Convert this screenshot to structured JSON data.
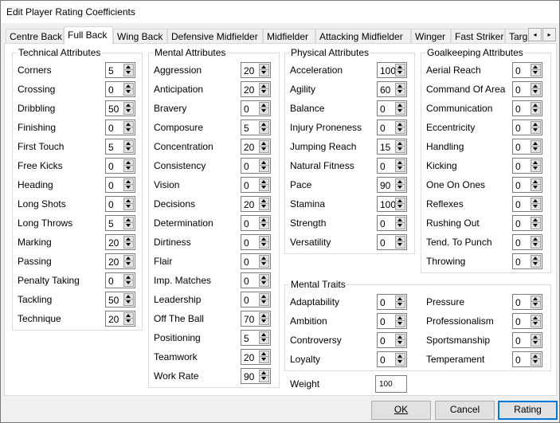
{
  "window": {
    "title": "Edit Player Rating Coefficients"
  },
  "tabs": [
    {
      "label": "Centre Back"
    },
    {
      "label": "Full Back",
      "active": true
    },
    {
      "label": "Wing Back"
    },
    {
      "label": "Defensive Midfielder"
    },
    {
      "label": "Midfielder"
    },
    {
      "label": "Attacking Midfielder"
    },
    {
      "label": "Winger"
    },
    {
      "label": "Fast Striker"
    },
    {
      "label": "Targ"
    }
  ],
  "tab_scroll": {
    "left_icon": "◂",
    "right_icon": "▸"
  },
  "groups": {
    "technical": {
      "title": "Technical Attributes",
      "items": [
        {
          "label": "Corners",
          "value": "5"
        },
        {
          "label": "Crossing",
          "value": "0"
        },
        {
          "label": "Dribbling",
          "value": "50"
        },
        {
          "label": "Finishing",
          "value": "0"
        },
        {
          "label": "First Touch",
          "value": "5"
        },
        {
          "label": "Free Kicks",
          "value": "0"
        },
        {
          "label": "Heading",
          "value": "0"
        },
        {
          "label": "Long Shots",
          "value": "0"
        },
        {
          "label": "Long Throws",
          "value": "5"
        },
        {
          "label": "Marking",
          "value": "20"
        },
        {
          "label": "Passing",
          "value": "20"
        },
        {
          "label": "Penalty Taking",
          "value": "0"
        },
        {
          "label": "Tackling",
          "value": "50"
        },
        {
          "label": "Technique",
          "value": "20"
        }
      ]
    },
    "mental": {
      "title": "Mental Attributes",
      "items": [
        {
          "label": "Aggression",
          "value": "20"
        },
        {
          "label": "Anticipation",
          "value": "20"
        },
        {
          "label": "Bravery",
          "value": "0"
        },
        {
          "label": "Composure",
          "value": "5"
        },
        {
          "label": "Concentration",
          "value": "20"
        },
        {
          "label": "Consistency",
          "value": "0"
        },
        {
          "label": "Vision",
          "value": "0"
        },
        {
          "label": "Decisions",
          "value": "20"
        },
        {
          "label": "Determination",
          "value": "0"
        },
        {
          "label": "Dirtiness",
          "value": "0"
        },
        {
          "label": "Flair",
          "value": "0"
        },
        {
          "label": "Imp. Matches",
          "value": "0"
        },
        {
          "label": "Leadership",
          "value": "0"
        },
        {
          "label": "Off The Ball",
          "value": "70"
        },
        {
          "label": "Positioning",
          "value": "5"
        },
        {
          "label": "Teamwork",
          "value": "20"
        },
        {
          "label": "Work Rate",
          "value": "90"
        }
      ]
    },
    "physical": {
      "title": "Physical Attributes",
      "items": [
        {
          "label": "Acceleration",
          "value": "100"
        },
        {
          "label": "Agility",
          "value": "60"
        },
        {
          "label": "Balance",
          "value": "0"
        },
        {
          "label": "Injury Proneness",
          "value": "0"
        },
        {
          "label": "Jumping Reach",
          "value": "15"
        },
        {
          "label": "Natural Fitness",
          "value": "0"
        },
        {
          "label": "Pace",
          "value": "90"
        },
        {
          "label": "Stamina",
          "value": "100"
        },
        {
          "label": "Strength",
          "value": "0"
        },
        {
          "label": "Versatility",
          "value": "0"
        }
      ]
    },
    "goalkeeping": {
      "title": "Goalkeeping Attributes",
      "items": [
        {
          "label": "Aerial Reach",
          "value": "0"
        },
        {
          "label": "Command Of Area",
          "value": "0"
        },
        {
          "label": "Communication",
          "value": "0"
        },
        {
          "label": "Eccentricity",
          "value": "0"
        },
        {
          "label": "Handling",
          "value": "0"
        },
        {
          "label": "Kicking",
          "value": "0"
        },
        {
          "label": "One On Ones",
          "value": "0"
        },
        {
          "label": "Reflexes",
          "value": "0"
        },
        {
          "label": "Rushing Out",
          "value": "0"
        },
        {
          "label": "Tend. To Punch",
          "value": "0"
        },
        {
          "label": "Throwing",
          "value": "0"
        }
      ]
    },
    "traits": {
      "title": "Mental Traits",
      "left": [
        {
          "label": "Adaptability",
          "value": "0"
        },
        {
          "label": "Ambition",
          "value": "0"
        },
        {
          "label": "Controversy",
          "value": "0"
        },
        {
          "label": "Loyalty",
          "value": "0"
        }
      ],
      "right": [
        {
          "label": "Pressure",
          "value": "0"
        },
        {
          "label": "Professionalism",
          "value": "0"
        },
        {
          "label": "Sportsmanship",
          "value": "0"
        },
        {
          "label": "Temperament",
          "value": "0"
        }
      ]
    }
  },
  "weight": {
    "label": "Weight",
    "value": "100"
  },
  "buttons": {
    "ok": {
      "label": "OK"
    },
    "cancel": {
      "label": "Cancel"
    },
    "rating": {
      "label": "Rating"
    }
  }
}
